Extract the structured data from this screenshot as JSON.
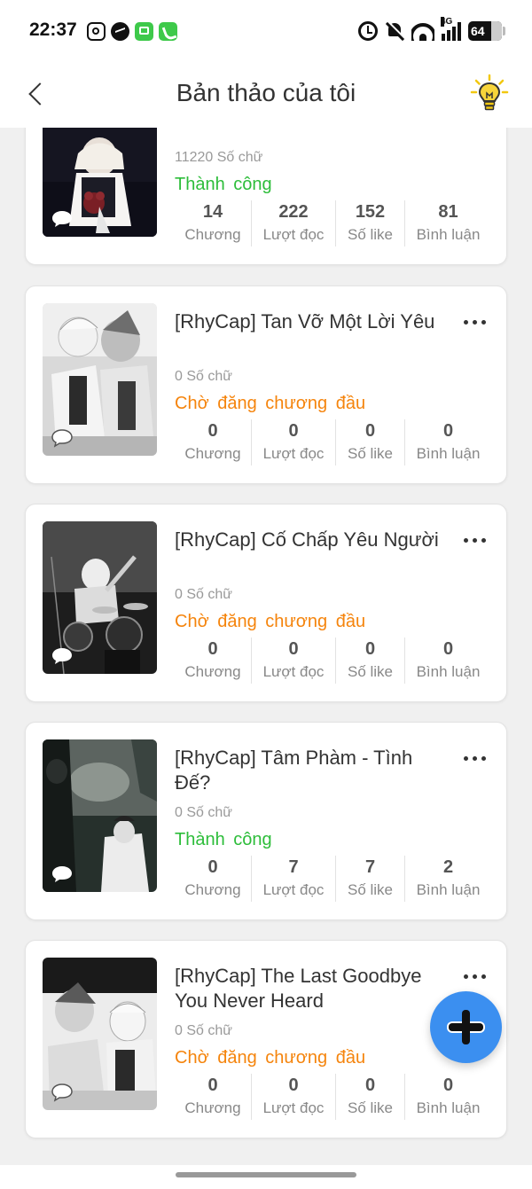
{
  "status_bar": {
    "time": "22:37",
    "network": "4G",
    "battery": "64"
  },
  "app_bar": {
    "title": "Bản thảo của tôi"
  },
  "books": [
    {
      "title": "",
      "word_count": "11220 Số chữ",
      "status": "Thành công",
      "status_type": "success",
      "action_icon": "exit-icon",
      "stats": [
        {
          "value": "14",
          "label": "Chương"
        },
        {
          "value": "222",
          "label": "Lượt đọc"
        },
        {
          "value": "152",
          "label": "Số like"
        },
        {
          "value": "81",
          "label": "Bình luận"
        }
      ]
    },
    {
      "title": "[RhyCap] Tan Vỡ Một Lời Yêu",
      "word_count": "0 Số chữ",
      "status": "Chờ đăng chương đầu",
      "status_type": "pending",
      "action_icon": "more-icon",
      "stats": [
        {
          "value": "0",
          "label": "Chương"
        },
        {
          "value": "0",
          "label": "Lượt đọc"
        },
        {
          "value": "0",
          "label": "Số like"
        },
        {
          "value": "0",
          "label": "Bình luận"
        }
      ]
    },
    {
      "title": "[RhyCap] Cố Chấp Yêu Người",
      "word_count": "0 Số chữ",
      "status": "Chờ đăng chương đầu",
      "status_type": "pending",
      "action_icon": "more-icon",
      "stats": [
        {
          "value": "0",
          "label": "Chương"
        },
        {
          "value": "0",
          "label": "Lượt đọc"
        },
        {
          "value": "0",
          "label": "Số like"
        },
        {
          "value": "0",
          "label": "Bình luận"
        }
      ]
    },
    {
      "title": "[RhyCap] Tâm Phàm - Tình Đế?",
      "word_count": "0 Số chữ",
      "status": "Thành công",
      "status_type": "success",
      "action_icon": "more-icon",
      "stats": [
        {
          "value": "0",
          "label": "Chương"
        },
        {
          "value": "7",
          "label": "Lượt đọc"
        },
        {
          "value": "7",
          "label": "Số like"
        },
        {
          "value": "2",
          "label": "Bình luận"
        }
      ]
    },
    {
      "title": "[RhyCap] The Last Goodbye You Never Heard",
      "word_count": "0 Số chữ",
      "status": "Chờ đăng chương đầu",
      "status_type": "pending",
      "action_icon": "more-icon",
      "stats": [
        {
          "value": "0",
          "label": "Chương"
        },
        {
          "value": "0",
          "label": "Lượt đọc"
        },
        {
          "value": "0",
          "label": "Số like"
        },
        {
          "value": "0",
          "label": "Bình luận"
        }
      ]
    }
  ],
  "colors": {
    "success": "#2dbd3a",
    "pending": "#f5840c",
    "fab": "#3b8ff0",
    "bulb": "#f2c811"
  }
}
